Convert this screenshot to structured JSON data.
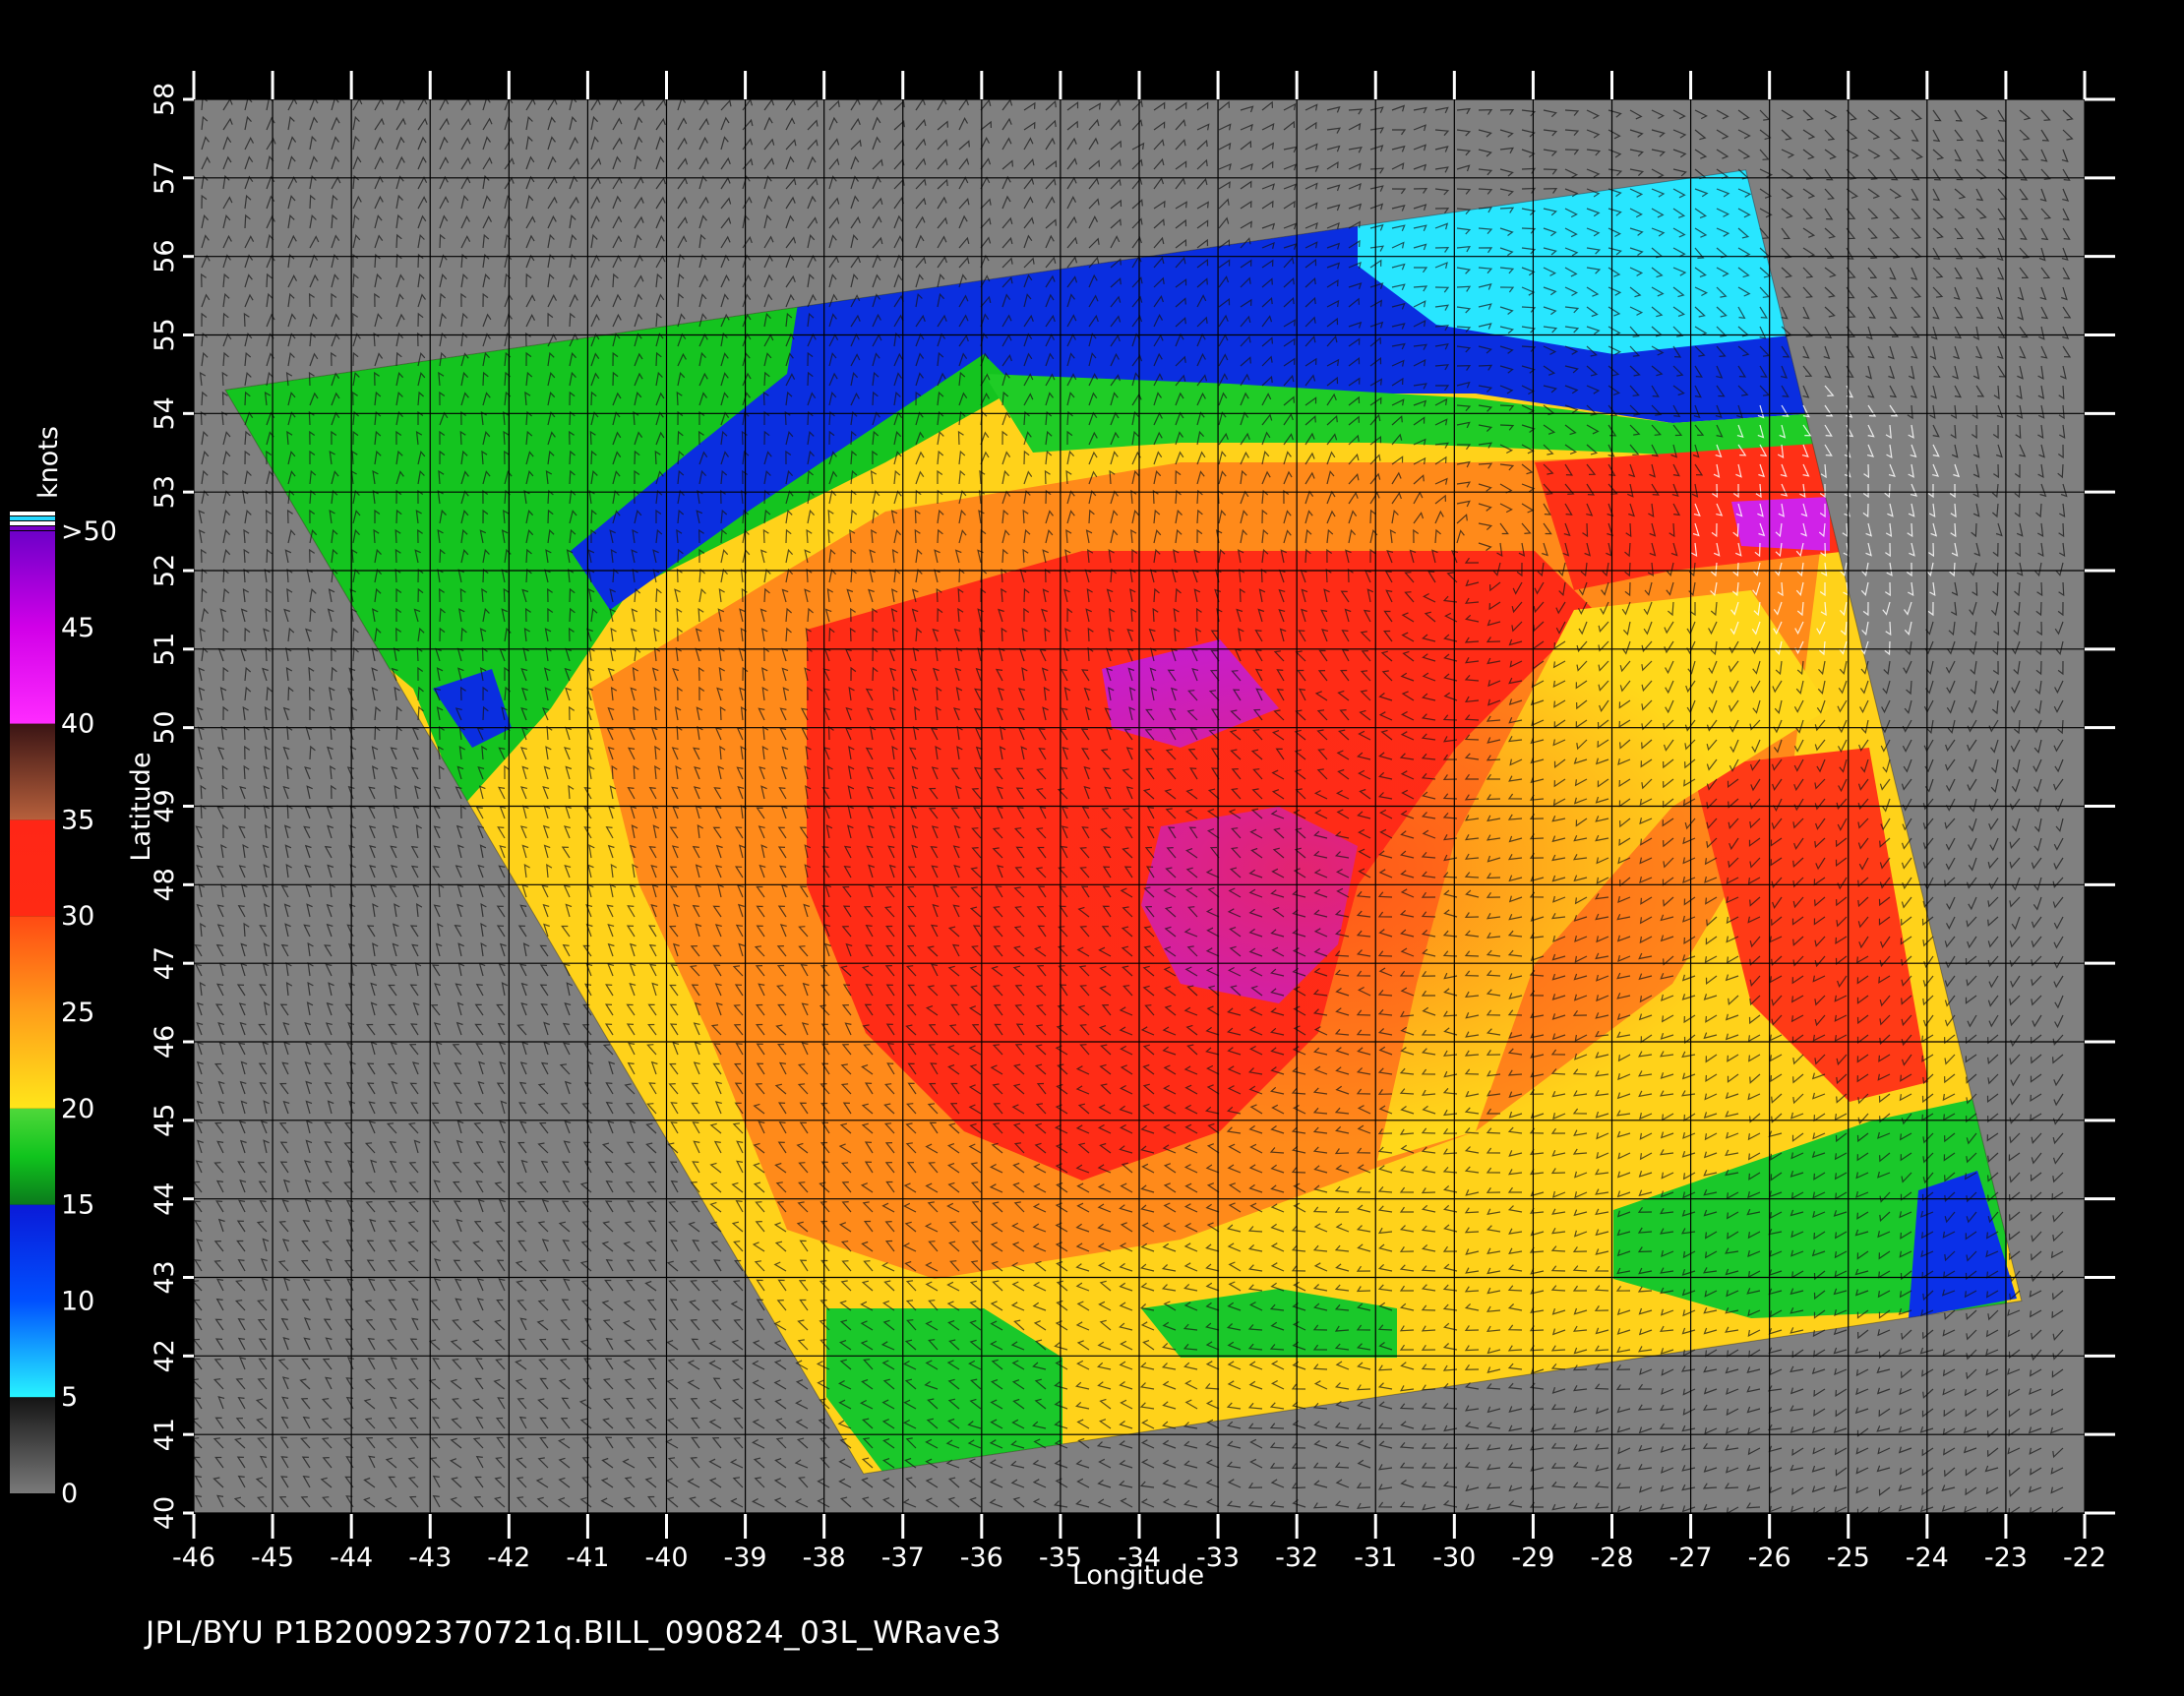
{
  "colorbar": {
    "unit_label": "knots",
    "bands": [
      {
        "from": 0,
        "to": 5,
        "colors": [
          "#7a7a7a",
          "#141414"
        ]
      },
      {
        "from": 5,
        "to": 15,
        "colors": [
          "#27f4ff",
          "#0050ff",
          "#0a1ad8"
        ]
      },
      {
        "from": 15,
        "to": 20,
        "colors": [
          "#0b7a1c",
          "#10c41d",
          "#4fd83a"
        ]
      },
      {
        "from": 20,
        "to": 30,
        "colors": [
          "#ffe61a",
          "#ff9f1a",
          "#ff4a14"
        ]
      },
      {
        "from": 30,
        "to": 35,
        "colors": [
          "#ff2a14",
          "#ff2616"
        ]
      },
      {
        "from": 35,
        "to": 40,
        "colors": [
          "#b7603c",
          "#3a1414"
        ]
      },
      {
        "from": 40,
        "to": 50,
        "colors": [
          "#ff2bff",
          "#d100e8",
          "#6d00c8"
        ]
      }
    ],
    "tick_labels": [
      "0",
      "5",
      "10",
      "15",
      "20",
      "25",
      "30",
      "35",
      "40",
      "45",
      ">50"
    ],
    "top_stripes": [
      "#ffffff",
      "#24d8ff",
      "#ffffff",
      "#7a00c8"
    ]
  },
  "map": {
    "lon_range": [
      -46,
      -22
    ],
    "lat_range": [
      40,
      58
    ],
    "lon_ticks": [
      "-46",
      "-45",
      "-44",
      "-43",
      "-42",
      "-41",
      "-40",
      "-39",
      "-38",
      "-37",
      "-36",
      "-35",
      "-34",
      "-33",
      "-32",
      "-31",
      "-30",
      "-29",
      "-28",
      "-27",
      "-26",
      "-25",
      "-24",
      "-23",
      "-22"
    ],
    "lat_ticks": [
      "40",
      "41",
      "42",
      "43",
      "44",
      "45",
      "46",
      "47",
      "48",
      "49",
      "50",
      "51",
      "52",
      "53",
      "54",
      "55",
      "56",
      "57",
      "58"
    ],
    "xlabel": "Longitude",
    "ylabel": "Latitude",
    "background": "#808080",
    "swath_corners": [
      {
        "lon": -45.6,
        "lat": 54.3
      },
      {
        "lon": -26.3,
        "lat": 57.1
      },
      {
        "lon": -22.8,
        "lat": 42.7
      },
      {
        "lon": -37.5,
        "lat": 40.5
      }
    ]
  },
  "footer": {
    "text": "JPL/BYU  P1B20092370721q.BILL_090824_03L_WRave3"
  }
}
